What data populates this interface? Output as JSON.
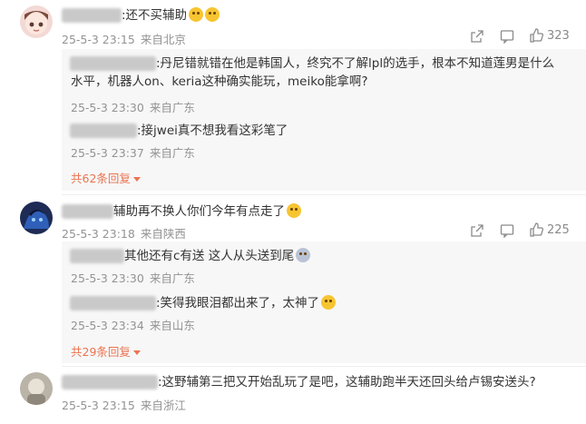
{
  "comments": [
    {
      "text": ":还不买辅助",
      "date": "25-5-3 23:15",
      "location": "来自北京",
      "likes": "323",
      "replies": [
        {
          "text": ":丹尼错就错在他是韩国人，终究不了解lpl的选手，根本不知道莲男是什么水平，机器人on、keria这种确实能玩，meiko能拿啊?",
          "date": "25-5-3 23:30",
          "location": "来自广东"
        },
        {
          "text": ":接jwei真不想我看这彩笔了",
          "date": "25-5-3 23:37",
          "location": "来自广东"
        }
      ],
      "more": "共62条回复"
    },
    {
      "text": "辅助再不换人你们今年有点走了",
      "date": "25-5-3 23:18",
      "location": "来自陕西",
      "likes": "225",
      "replies": [
        {
          "text": "其他还有c有送 这人从头送到尾",
          "date": "25-5-3 23:30",
          "location": "来自广东"
        },
        {
          "text": ":笑得我眼泪都出来了，太神了",
          "date": "25-5-3 23:34",
          "location": "来自山东"
        }
      ],
      "more": "共29条回复"
    },
    {
      "text": ":这野辅第三把又开始乱玩了是吧，这辅助跑半天还回头给卢锡安送头?",
      "date": "25-5-3 23:15",
      "location": "来自浙江"
    }
  ]
}
